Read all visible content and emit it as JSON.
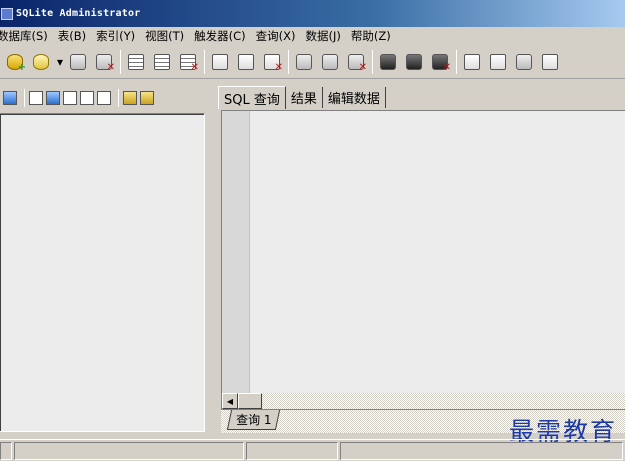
{
  "window": {
    "title": "SQLite Administrator"
  },
  "menubar": {
    "items": [
      {
        "label": "数据库(S)"
      },
      {
        "label": "表(B)"
      },
      {
        "label": "索引(Y)"
      },
      {
        "label": "视图(T)"
      },
      {
        "label": "触发器(C)"
      },
      {
        "label": "查询(X)"
      },
      {
        "label": "数据(J)"
      },
      {
        "label": "帮助(Z)"
      }
    ]
  },
  "toolbar": {
    "icons": [
      "new-database-icon",
      "open-database-icon",
      "dropdown-arrow-icon",
      "database-connect-icon",
      "delete-database-icon",
      "table-icon",
      "new-table-icon",
      "delete-table-icon",
      "index-icon",
      "new-index-icon",
      "delete-index-icon",
      "view-icon",
      "new-view-icon",
      "delete-view-icon",
      "trigger-icon",
      "new-trigger-icon",
      "delete-trigger-icon",
      "document-icon",
      "export-icon",
      "settings-icon",
      "tools-icon"
    ]
  },
  "main": {
    "tabs": [
      {
        "label": "SQL 查询",
        "active": true
      },
      {
        "label": "结果",
        "active": false
      },
      {
        "label": "编辑数据",
        "active": false
      }
    ],
    "query_tab": {
      "label": "查询 1"
    }
  },
  "watermark": {
    "text": "最需教育"
  },
  "colors": {
    "title_bar": "#0a246a",
    "face": "#d4d0c8",
    "watermark": "#1b3aa8"
  }
}
